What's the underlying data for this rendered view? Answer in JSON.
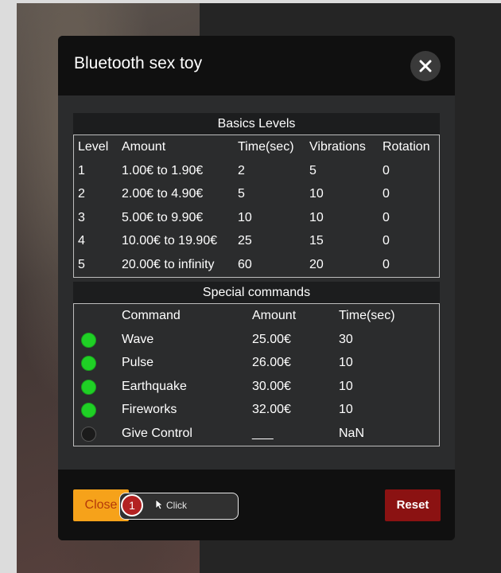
{
  "modal": {
    "title": "Bluetooth sex toy",
    "close_icon": "close-icon"
  },
  "basics": {
    "title": "Basics Levels",
    "columns": [
      "Level",
      "Amount",
      "Time(sec)",
      "Vibrations",
      "Rotation"
    ],
    "rows": [
      [
        "1",
        "1.00€ to 1.90€",
        "2",
        "5",
        "0"
      ],
      [
        "2",
        "2.00€ to 4.90€",
        "5",
        "10",
        "0"
      ],
      [
        "3",
        "5.00€ to 9.90€",
        "10",
        "10",
        "0"
      ],
      [
        "4",
        "10.00€ to 19.90€",
        "25",
        "15",
        "0"
      ],
      [
        "5",
        "20.00€ to infinity",
        "60",
        "20",
        "0"
      ]
    ]
  },
  "special": {
    "title": "Special commands",
    "columns": [
      "Command",
      "Amount",
      "Time(sec)"
    ],
    "rows": [
      {
        "status": "active",
        "command": "Wave",
        "amount": "25.00€",
        "time": "30"
      },
      {
        "status": "active",
        "command": "Pulse",
        "amount": "26.00€",
        "time": "10"
      },
      {
        "status": "active",
        "command": "Earthquake",
        "amount": "30.00€",
        "time": "10"
      },
      {
        "status": "active",
        "command": "Fireworks",
        "amount": "32.00€",
        "time": "10"
      },
      {
        "status": "inactive",
        "command": "Give Control",
        "amount": "___",
        "time": "NaN"
      }
    ]
  },
  "footer": {
    "close_label": "Close",
    "reset_label": "Reset"
  },
  "annotation": {
    "step": "1",
    "label": "Click",
    "cursor_icon": "pointer-cursor-icon"
  },
  "colors": {
    "status_active": "#1fd025",
    "status_inactive": "#1b1b1b",
    "close_button": "#f6a21a",
    "reset_button": "#8b1212"
  }
}
